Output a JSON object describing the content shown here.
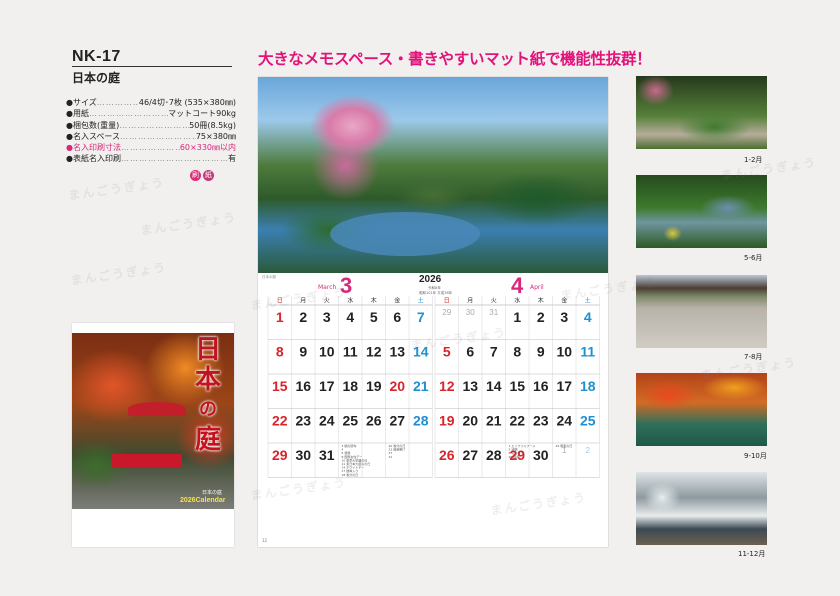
{
  "left": {
    "model_code": "NK-17",
    "product_name": "日本の庭",
    "specs": [
      {
        "label": "●サイズ",
        "value": "46/4切･7枚 (535×380㎜)",
        "highlight": false
      },
      {
        "label": "●用紙",
        "value": "マットコート90kg",
        "highlight": false
      },
      {
        "label": "●梱包数(重量)",
        "value": "50冊(8.5kg)",
        "highlight": false
      },
      {
        "label": "●名入スペース",
        "value": "75×380㎜",
        "highlight": false
      },
      {
        "label": "●名入印刷寸法",
        "value": "60×330㎜以内",
        "highlight": true
      },
      {
        "label": "●表紙名入印刷",
        "value": "有",
        "highlight": false
      }
    ],
    "marks": [
      "刷",
      "紙"
    ],
    "mark_colors": [
      "#e02c72",
      "#c0397c"
    ],
    "cover": {
      "title_chars": [
        "日",
        "本",
        "の",
        "庭"
      ],
      "subtitle": "日本の庭",
      "caption": "2026Calendar"
    }
  },
  "headline": "大きなメモスペース・書きやすいマット紙で機能性抜群！",
  "calendar": {
    "note": "日本の庭",
    "year": "2026",
    "era_lines": [
      "令和8年",
      "昭和101年  平成38年"
    ],
    "weekday_headers": [
      "日",
      "月",
      "火",
      "水",
      "木",
      "金",
      "土"
    ],
    "weekday_colors": [
      "#d8242b",
      "#333333",
      "#333333",
      "#333333",
      "#333333",
      "#333333",
      "#1e8fd0"
    ],
    "month_a": {
      "number": "3",
      "name_en": "March",
      "prev_month_days": [],
      "rows": [
        [
          "1",
          "2",
          "3",
          "4",
          "5",
          "6",
          "7"
        ],
        [
          "8",
          "9",
          "10",
          "11",
          "12",
          "13",
          "14"
        ],
        [
          "15",
          "16",
          "17",
          "18",
          "19",
          "20",
          "21"
        ],
        [
          "22",
          "23",
          "24",
          "25",
          "26",
          "27",
          "28"
        ],
        [
          "29",
          "30",
          "31",
          "",
          "",
          "",
          ""
        ]
      ],
      "holidays": [
        "20"
      ],
      "memo_left": [
        "3 桃の節句",
        "4 ",
        "5 啓蟄",
        "8 国際女性デー",
        "10 東京大空襲の日",
        "11 東日本大震災の日",
        "14 ホワイトデー",
        "17 彼岸入り",
        "18 春分の日"
      ],
      "memo_right": [
        "20 春分の日",
        "23 彼岸明け",
        "27 ",
        "31 "
      ]
    },
    "month_b": {
      "number": "4",
      "name_en": "April",
      "rows": [
        [
          "29",
          "30",
          "31",
          "1",
          "2",
          "3",
          "4"
        ],
        [
          "5",
          "6",
          "7",
          "8",
          "9",
          "10",
          "11"
        ],
        [
          "12",
          "13",
          "14",
          "15",
          "16",
          "17",
          "18"
        ],
        [
          "19",
          "20",
          "21",
          "22",
          "23",
          "24",
          "25"
        ],
        [
          "26",
          "27",
          "28",
          "29",
          "30",
          "1",
          "2"
        ]
      ],
      "holidays": [
        "29"
      ],
      "faded": [
        "r0c0",
        "r0c1",
        "r0c2",
        "r4c5",
        "r4c6"
      ],
      "memo_left": [
        "1 エイプリルフール",
        "5 清明",
        "8 花まつり",
        "20 穀雨"
      ],
      "memo_right": [
        "29 昭和の日"
      ]
    },
    "page_number": "12"
  },
  "thumbnails": [
    {
      "label": "1-2月"
    },
    {
      "label": "5-6月"
    },
    {
      "label": "7-8月"
    },
    {
      "label": "9-10月"
    },
    {
      "label": "11-12月"
    }
  ],
  "watermark": "まんごうぎょう",
  "colors": {
    "accent_pink": "#e3127a",
    "sunday_red": "#d8242b",
    "saturday_blue": "#1e8fd0",
    "month_a_pink": "#d6297a"
  }
}
